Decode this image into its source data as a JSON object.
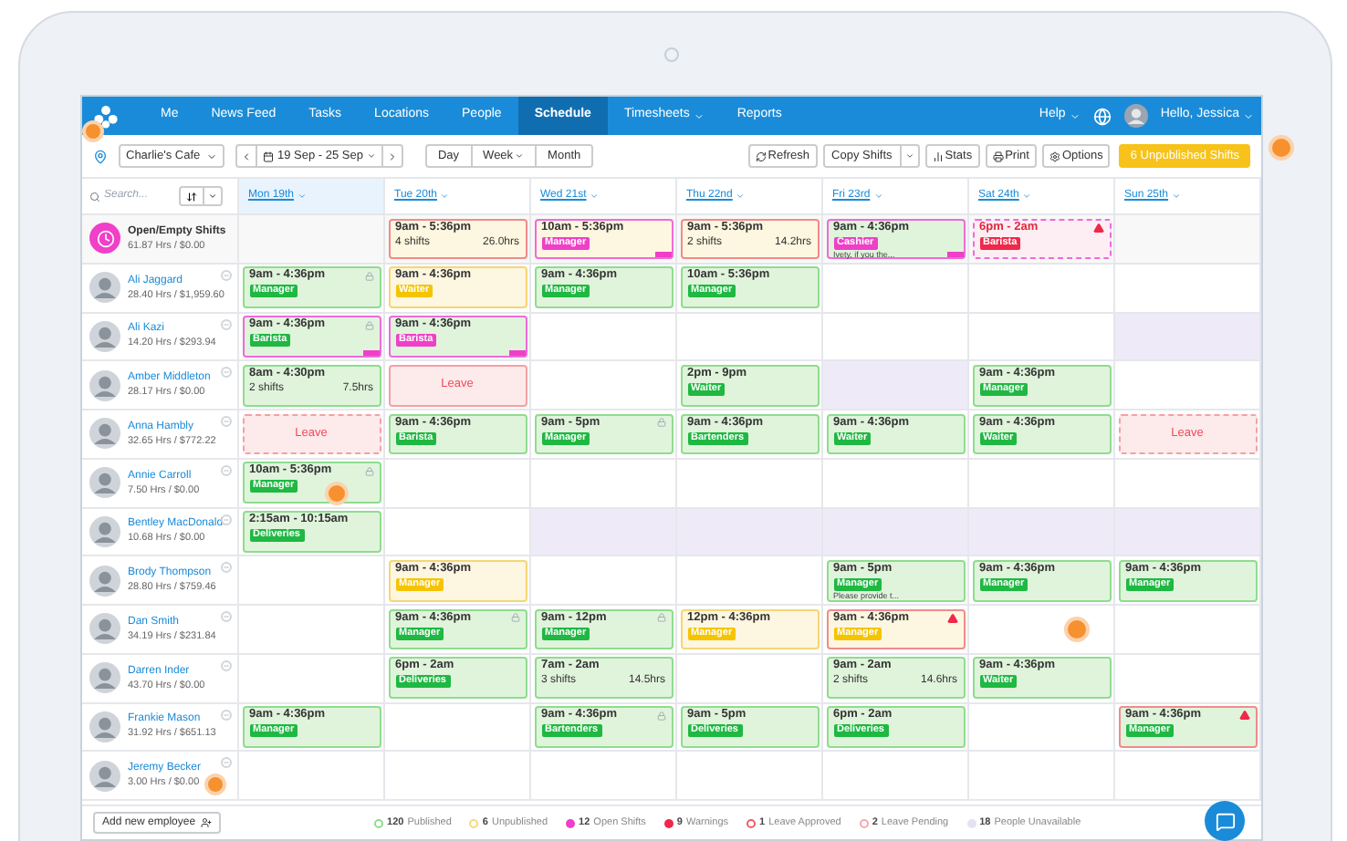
{
  "nav": {
    "items": [
      {
        "label": "Me",
        "selected": false,
        "dropdown": false
      },
      {
        "label": "News Feed",
        "selected": false,
        "dropdown": false
      },
      {
        "label": "Tasks",
        "selected": false,
        "dropdown": false
      },
      {
        "label": "Locations",
        "selected": false,
        "dropdown": false
      },
      {
        "label": "People",
        "selected": false,
        "dropdown": false
      },
      {
        "label": "Schedule",
        "selected": true,
        "dropdown": false
      },
      {
        "label": "Timesheets",
        "selected": false,
        "dropdown": true
      },
      {
        "label": "Reports",
        "selected": false,
        "dropdown": false
      }
    ],
    "help": "Help",
    "user": "Hello, Jessica"
  },
  "toolbar": {
    "location": "Charlie's Cafe",
    "date_range": "19 Sep - 25 Sep",
    "views": [
      {
        "label": "Day",
        "dropdown": false
      },
      {
        "label": "Week",
        "dropdown": true
      },
      {
        "label": "Month",
        "dropdown": false
      }
    ],
    "actions": [
      {
        "label": "Refresh",
        "kind": "refresh"
      },
      {
        "label": "Copy Shifts",
        "kind": "split"
      },
      {
        "label": "Stats",
        "kind": "stats"
      },
      {
        "label": "Print",
        "kind": "print"
      },
      {
        "label": "Options",
        "kind": "options"
      }
    ],
    "publish": "6 Unpublished Shifts"
  },
  "search": {
    "placeholder": "Search..."
  },
  "days": [
    {
      "label": "Mon 19th",
      "selected": true
    },
    {
      "label": "Tue 20th",
      "selected": false
    },
    {
      "label": "Wed 21st",
      "selected": false
    },
    {
      "label": "Thu 22nd",
      "selected": false
    },
    {
      "label": "Fri 23rd",
      "selected": false
    },
    {
      "label": "Sat 24th",
      "selected": false
    },
    {
      "label": "Sun 25th",
      "selected": false
    }
  ],
  "rows": [
    {
      "name": "Open/Empty Shifts",
      "kind": "open",
      "stats": "61.87 Hrs / $0.00",
      "cells": [
        {
          "kind": "empty"
        },
        {
          "kind": "summary",
          "time": "9am - 5:36pm",
          "shifts": "4 shifts",
          "hours": "26.0hrs",
          "published": false,
          "flagged": true
        },
        {
          "kind": "shift",
          "time": "10am - 5:36pm",
          "tag": {
            "label": "Manager",
            "color": "#f03fc8"
          },
          "published": false,
          "open": true,
          "open_badge": true
        },
        {
          "kind": "summary",
          "time": "9am - 5:36pm",
          "shifts": "2 shifts",
          "hours": "14.2hrs",
          "published": false,
          "flagged": true
        },
        {
          "kind": "shift",
          "time": "9am - 4:36pm",
          "tag": {
            "label": "Cashier",
            "color": "#f03fc8"
          },
          "note": "Ivety, if you the...",
          "published": true,
          "open": true,
          "open_badge": true
        },
        {
          "kind": "unfilled",
          "time": "6pm - 2am",
          "tag": {
            "label": "Barista",
            "color": "#f0284a"
          },
          "warning": true
        },
        {
          "kind": "empty"
        }
      ]
    },
    {
      "name": "Ali Jaggard",
      "kind": "employee",
      "stats": "28.40 Hrs / $1,959.60",
      "cells": [
        {
          "kind": "shift",
          "time": "9am - 4:36pm",
          "tag": {
            "label": "Manager",
            "color": "#1fb842"
          },
          "published": true,
          "locked": true
        },
        {
          "kind": "shift",
          "time": "9am - 4:36pm",
          "tag": {
            "label": "Waiter",
            "color": "#f5c400"
          },
          "published": false
        },
        {
          "kind": "shift",
          "time": "9am - 4:36pm",
          "tag": {
            "label": "Manager",
            "color": "#1fb842"
          },
          "published": true
        },
        {
          "kind": "shift",
          "time": "10am - 5:36pm",
          "tag": {
            "label": "Manager",
            "color": "#1fb842"
          },
          "published": true
        },
        {
          "kind": "empty"
        },
        {
          "kind": "empty"
        },
        {
          "kind": "empty"
        }
      ]
    },
    {
      "name": "Ali Kazi",
      "kind": "employee",
      "stats": "14.20 Hrs / $293.94",
      "cells": [
        {
          "kind": "shift",
          "time": "9am - 4:36pm",
          "tag": {
            "label": "Barista",
            "color": "#1fb842"
          },
          "published": true,
          "open": true,
          "locked": true,
          "open_badge": true
        },
        {
          "kind": "shift",
          "time": "9am - 4:36pm",
          "tag": {
            "label": "Barista",
            "color": "#f03fc8"
          },
          "published": true,
          "open": true,
          "open_badge": true
        },
        {
          "kind": "empty"
        },
        {
          "kind": "empty"
        },
        {
          "kind": "empty"
        },
        {
          "kind": "empty"
        },
        {
          "kind": "unavailable"
        }
      ]
    },
    {
      "name": "Amber Middleton",
      "kind": "employee",
      "stats": "28.17 Hrs / $0.00",
      "cells": [
        {
          "kind": "summary",
          "time": "8am - 4:30pm",
          "shifts": "2 shifts",
          "hours": "7.5hrs",
          "published": true
        },
        {
          "kind": "leave",
          "label": "Leave",
          "pending": false
        },
        {
          "kind": "empty"
        },
        {
          "kind": "shift",
          "time": "2pm - 9pm",
          "tag": {
            "label": "Waiter",
            "color": "#1fb842"
          },
          "published": true
        },
        {
          "kind": "unavailable"
        },
        {
          "kind": "shift",
          "time": "9am - 4:36pm",
          "tag": {
            "label": "Manager",
            "color": "#1fb842"
          },
          "published": true
        },
        {
          "kind": "empty"
        }
      ]
    },
    {
      "name": "Anna Hambly",
      "kind": "employee",
      "stats": "32.65 Hrs / $772.22",
      "cells": [
        {
          "kind": "leave",
          "label": "Leave",
          "pending": true
        },
        {
          "kind": "shift",
          "time": "9am - 4:36pm",
          "tag": {
            "label": "Barista",
            "color": "#1fb842"
          },
          "published": true
        },
        {
          "kind": "shift",
          "time": "9am - 5pm",
          "tag": {
            "label": "Manager",
            "color": "#1fb842"
          },
          "published": true,
          "locked": true
        },
        {
          "kind": "shift",
          "time": "9am - 4:36pm",
          "tag": {
            "label": "Bartenders",
            "color": "#1fb842"
          },
          "published": true
        },
        {
          "kind": "shift",
          "time": "9am - 4:36pm",
          "tag": {
            "label": "Waiter",
            "color": "#1fb842"
          },
          "published": true
        },
        {
          "kind": "shift",
          "time": "9am - 4:36pm",
          "tag": {
            "label": "Waiter",
            "color": "#1fb842"
          },
          "published": true
        },
        {
          "kind": "leave",
          "label": "Leave",
          "pending": true
        }
      ]
    },
    {
      "name": "Annie Carroll",
      "kind": "employee",
      "stats": "7.50 Hrs / $0.00",
      "cells": [
        {
          "kind": "shift",
          "time": "10am - 5:36pm",
          "tag": {
            "label": "Manager",
            "color": "#1fb842"
          },
          "published": true,
          "locked": true
        },
        {
          "kind": "empty"
        },
        {
          "kind": "empty"
        },
        {
          "kind": "empty"
        },
        {
          "kind": "empty"
        },
        {
          "kind": "empty"
        },
        {
          "kind": "empty"
        }
      ]
    },
    {
      "name": "Bentley MacDonald",
      "kind": "employee",
      "stats": "10.68 Hrs / $0.00",
      "cells": [
        {
          "kind": "shift",
          "time": "2:15am - 10:15am",
          "tag": {
            "label": "Deliveries",
            "color": "#1fb842"
          },
          "published": true
        },
        {
          "kind": "empty"
        },
        {
          "kind": "unavailable"
        },
        {
          "kind": "unavailable"
        },
        {
          "kind": "unavailable"
        },
        {
          "kind": "unavailable"
        },
        {
          "kind": "unavailable"
        }
      ]
    },
    {
      "name": "Brody Thompson",
      "kind": "employee",
      "stats": "28.80 Hrs / $759.46",
      "cells": [
        {
          "kind": "empty"
        },
        {
          "kind": "shift",
          "time": "9am - 4:36pm",
          "tag": {
            "label": "Manager",
            "color": "#f5c400"
          },
          "published": false
        },
        {
          "kind": "empty"
        },
        {
          "kind": "empty"
        },
        {
          "kind": "shift",
          "time": "9am - 5pm",
          "tag": {
            "label": "Manager",
            "color": "#1fb842"
          },
          "note": "Please provide t...",
          "published": true
        },
        {
          "kind": "shift",
          "time": "9am - 4:36pm",
          "tag": {
            "label": "Manager",
            "color": "#1fb842"
          },
          "published": true
        },
        {
          "kind": "shift",
          "time": "9am - 4:36pm",
          "tag": {
            "label": "Manager",
            "color": "#1fb842"
          },
          "published": true
        }
      ]
    },
    {
      "name": "Dan Smith",
      "kind": "employee",
      "stats": "34.19 Hrs / $231.84",
      "cells": [
        {
          "kind": "empty"
        },
        {
          "kind": "shift",
          "time": "9am - 4:36pm",
          "tag": {
            "label": "Manager",
            "color": "#1fb842"
          },
          "published": true,
          "locked": true
        },
        {
          "kind": "shift",
          "time": "9am - 12pm",
          "tag": {
            "label": "Manager",
            "color": "#1fb842"
          },
          "published": true,
          "locked": true
        },
        {
          "kind": "shift",
          "time": "12pm - 4:36pm",
          "tag": {
            "label": "Manager",
            "color": "#f5c400"
          },
          "published": false
        },
        {
          "kind": "shift",
          "time": "9am - 4:36pm",
          "tag": {
            "label": "Manager",
            "color": "#f5c400"
          },
          "published": false,
          "flagged": true,
          "warning": true
        },
        {
          "kind": "empty"
        },
        {
          "kind": "empty"
        }
      ]
    },
    {
      "name": "Darren Inder",
      "kind": "employee",
      "stats": "43.70 Hrs / $0.00",
      "cells": [
        {
          "kind": "empty"
        },
        {
          "kind": "shift",
          "time": "6pm - 2am",
          "tag": {
            "label": "Deliveries",
            "color": "#1fb842"
          },
          "published": true
        },
        {
          "kind": "summary",
          "time": "7am - 2am",
          "shifts": "3 shifts",
          "hours": "14.5hrs",
          "published": true
        },
        {
          "kind": "empty"
        },
        {
          "kind": "summary",
          "time": "9am - 2am",
          "shifts": "2 shifts",
          "hours": "14.6hrs",
          "published": true
        },
        {
          "kind": "shift",
          "time": "9am - 4:36pm",
          "tag": {
            "label": "Waiter",
            "color": "#1fb842"
          },
          "published": true
        },
        {
          "kind": "empty"
        }
      ]
    },
    {
      "name": "Frankie Mason",
      "kind": "employee",
      "stats": "31.92 Hrs / $651.13",
      "cells": [
        {
          "kind": "shift",
          "time": "9am - 4:36pm",
          "tag": {
            "label": "Manager",
            "color": "#1fb842"
          },
          "published": true
        },
        {
          "kind": "empty"
        },
        {
          "kind": "shift",
          "time": "9am - 4:36pm",
          "tag": {
            "label": "Bartenders",
            "color": "#1fb842"
          },
          "published": true,
          "locked": true
        },
        {
          "kind": "shift",
          "time": "9am - 5pm",
          "tag": {
            "label": "Deliveries",
            "color": "#1fb842"
          },
          "published": true
        },
        {
          "kind": "shift",
          "time": "6pm - 2am",
          "tag": {
            "label": "Deliveries",
            "color": "#1fb842"
          },
          "published": true
        },
        {
          "kind": "empty"
        },
        {
          "kind": "shift",
          "time": "9am - 4:36pm",
          "tag": {
            "label": "Manager",
            "color": "#1fb842"
          },
          "published": true,
          "flagged": true,
          "warning": true
        }
      ]
    },
    {
      "name": "Jeremy Becker",
      "kind": "employee",
      "stats": "3.00 Hrs / $0.00",
      "cells": [
        {
          "kind": "empty"
        },
        {
          "kind": "empty"
        },
        {
          "kind": "empty"
        },
        {
          "kind": "empty"
        },
        {
          "kind": "empty"
        },
        {
          "kind": "empty"
        },
        {
          "kind": "empty"
        }
      ]
    }
  ],
  "footer": {
    "add_button": "Add new employee",
    "legend": [
      {
        "count": "120",
        "label": "Published",
        "color": "#8fdc8f",
        "kind": "ring"
      },
      {
        "count": "6",
        "label": "Unpublished",
        "color": "#f7d97a",
        "kind": "ring"
      },
      {
        "count": "12",
        "label": "Open Shifts",
        "color": "#f03fc8",
        "kind": "dot"
      },
      {
        "count": "9",
        "label": "Warnings",
        "color": "#f0284a",
        "kind": "dot"
      },
      {
        "count": "1",
        "label": "Leave Approved",
        "color": "#f05a6a",
        "kind": "ring"
      },
      {
        "count": "2",
        "label": "Leave Pending",
        "color": "#f5a8b4",
        "kind": "ring"
      },
      {
        "count": "18",
        "label": "People Unavailable",
        "color": "#e6e0f5",
        "kind": "dot"
      }
    ]
  }
}
